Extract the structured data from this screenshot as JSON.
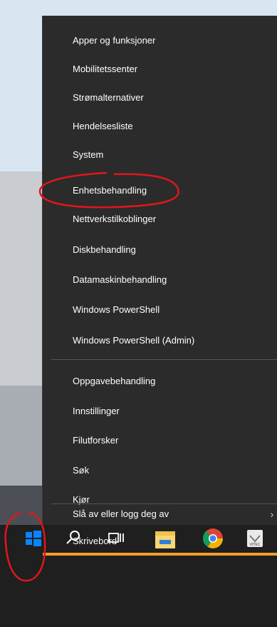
{
  "menu": {
    "group1": [
      "Apper og funksjoner",
      "Mobilitetssenter",
      "Strømalternativer",
      "Hendelsesliste",
      "System",
      "Enhetsbehandling",
      "Nettverkstilkoblinger",
      "Diskbehandling",
      "Datamaskinbehandling",
      "Windows PowerShell",
      "Windows PowerShell (Admin)"
    ],
    "group2": [
      "Oppgavebehandling",
      "Innstillinger",
      "Filutforsker",
      "Søk",
      "Kjør"
    ],
    "group3": [
      "Slå av eller logg deg av",
      "Skrivebord"
    ],
    "submenu_arrow": "›"
  },
  "taskbar": {
    "icons": [
      "windows-start-icon",
      "search-icon",
      "task-view-icon",
      "file-explorer-icon",
      "chrome-icon",
      "vitec-app-icon"
    ],
    "vitec_label": "VITEC",
    "accent_color": "#f39c2a"
  },
  "annotation_color": "#e0161c"
}
